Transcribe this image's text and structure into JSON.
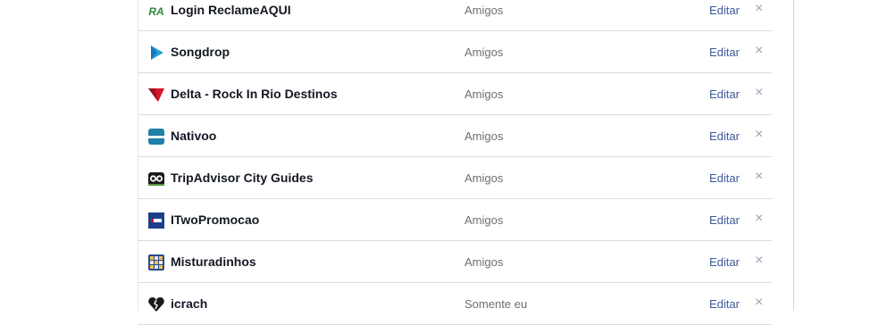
{
  "apps": [
    {
      "name": "Login ReclameAQUI",
      "audience": "Amigos",
      "icon": "reclameaqui-logo-icon",
      "icon_text": "RA",
      "edit_label": "Editar",
      "remove_glyph": "×"
    },
    {
      "name": "Songdrop",
      "audience": "Amigos",
      "icon": "songdrop-play-icon",
      "edit_label": "Editar",
      "remove_glyph": "×"
    },
    {
      "name": "Delta - Rock In Rio Destinos",
      "audience": "Amigos",
      "icon": "delta-logo-icon",
      "edit_label": "Editar",
      "remove_glyph": "×"
    },
    {
      "name": "Nativoo",
      "audience": "Amigos",
      "icon": "nativoo-logo-icon",
      "edit_label": "Editar",
      "remove_glyph": "×"
    },
    {
      "name": "TripAdvisor City Guides",
      "audience": "Amigos",
      "icon": "tripadvisor-owl-icon",
      "edit_label": "Editar",
      "remove_glyph": "×"
    },
    {
      "name": "ITwoPromocao",
      "audience": "Amigos",
      "icon": "itwo-logo-icon",
      "edit_label": "Editar",
      "remove_glyph": "×"
    },
    {
      "name": "Misturadinhos",
      "audience": "Amigos",
      "icon": "misturadinhos-grid-icon",
      "edit_label": "Editar",
      "remove_glyph": "×"
    },
    {
      "name": "icrach",
      "audience": "Somente eu",
      "icon": "broken-heart-icon",
      "edit_label": "Editar",
      "remove_glyph": "×"
    }
  ],
  "colors": {
    "link": "#3b5998",
    "muted": "#6d6f74",
    "name": "#141823",
    "divider": "#d8dbe0",
    "remove": "#9aa2b3"
  }
}
